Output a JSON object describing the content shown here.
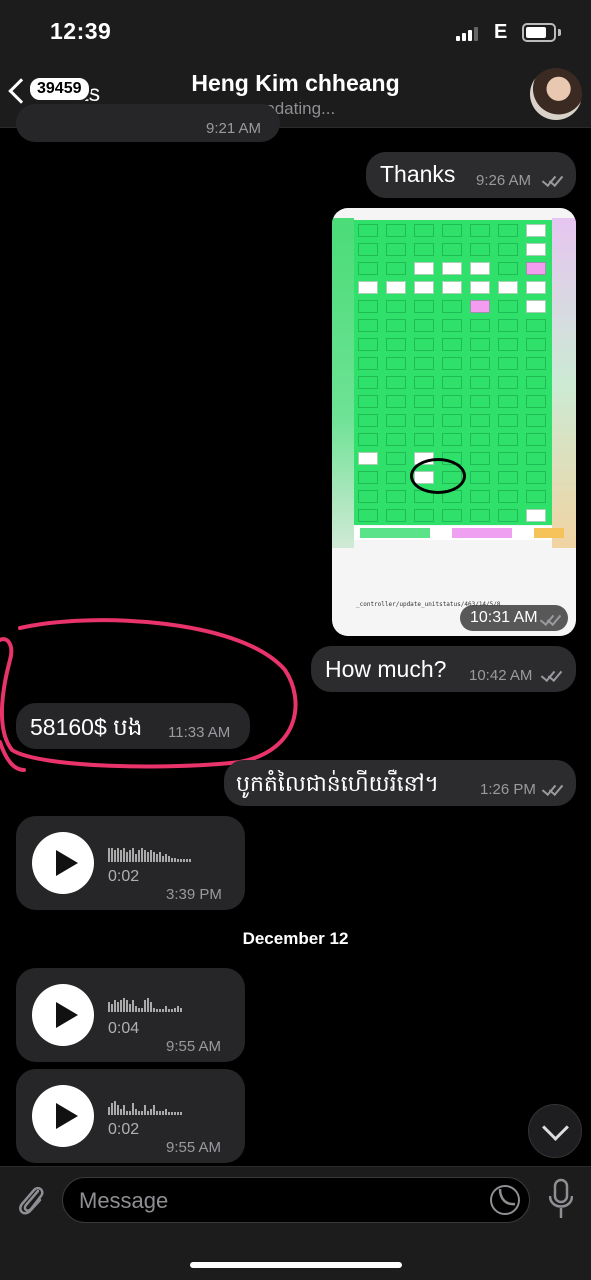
{
  "status": {
    "time": "12:39",
    "network": "E"
  },
  "header": {
    "back_label": "Chats",
    "unread_count": "39459",
    "title": "Heng Kim chheang",
    "subtitle": "updating..."
  },
  "messages": {
    "partial_prev_time": "9:21 AM",
    "thanks": {
      "text": "Thanks",
      "time": "9:26 AM"
    },
    "image": {
      "time": "10:31 AM",
      "url_text": "_controller/update_unitstatus/463/14/5/8"
    },
    "how_much": {
      "text": "How much?",
      "time": "10:42 AM"
    },
    "price": {
      "text": "58160$ បង",
      "time": "11:33 AM"
    },
    "khmer": {
      "text": "បូកតំលៃជាន់ហើយរឺនៅ។",
      "time": "1:26 PM"
    },
    "voice1": {
      "duration": "0:02",
      "time": "3:39 PM"
    },
    "date_separator": "December 12",
    "voice2": {
      "duration": "0:04",
      "time": "9:55 AM"
    },
    "voice3": {
      "duration": "0:02",
      "time": "9:55 AM"
    }
  },
  "input": {
    "placeholder": "Message"
  },
  "icons": [
    "back-chevron-icon",
    "signal-icon",
    "battery-icon",
    "check-marks-icon",
    "play-icon",
    "attach-icon",
    "sticker-icon",
    "mic-icon",
    "chevron-down-icon"
  ],
  "colors": {
    "background": "#000000",
    "bubble": "#2c2c2e",
    "annotation": "#e8336b"
  }
}
